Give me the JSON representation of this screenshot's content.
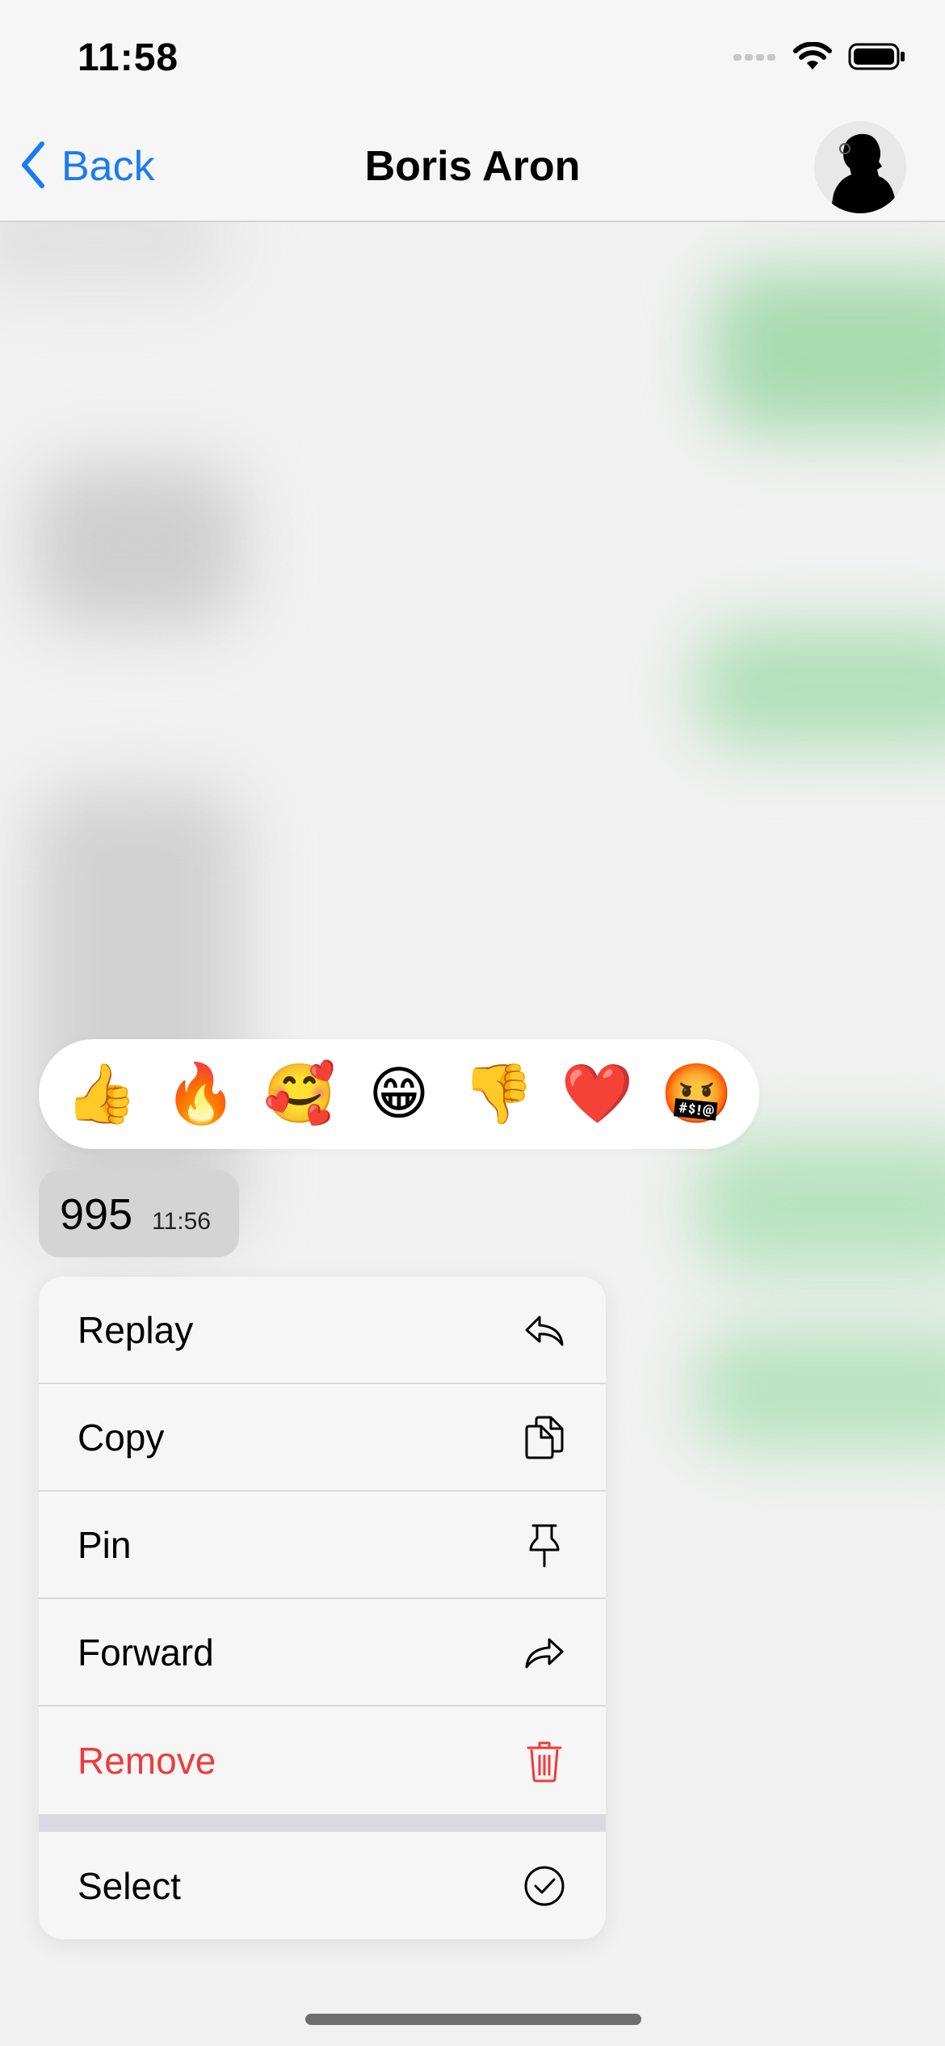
{
  "status_bar": {
    "time": "11:58"
  },
  "nav": {
    "back_label": "Back",
    "title": "Boris Aron"
  },
  "reactions": [
    "👍",
    "🔥",
    "🥰",
    "😁",
    "👎",
    "❤️",
    "🤬"
  ],
  "message": {
    "text": "995",
    "time": "11:56"
  },
  "menu": {
    "reply": "Replay",
    "copy": "Copy",
    "pin": "Pin",
    "forward": "Forward",
    "remove": "Remove",
    "select": "Select"
  },
  "colors": {
    "accent": "#1a7cf0",
    "danger": "#ee3b3b",
    "bubble_other": "#d4d4d4",
    "bubble_own": "#a8dbb0"
  }
}
